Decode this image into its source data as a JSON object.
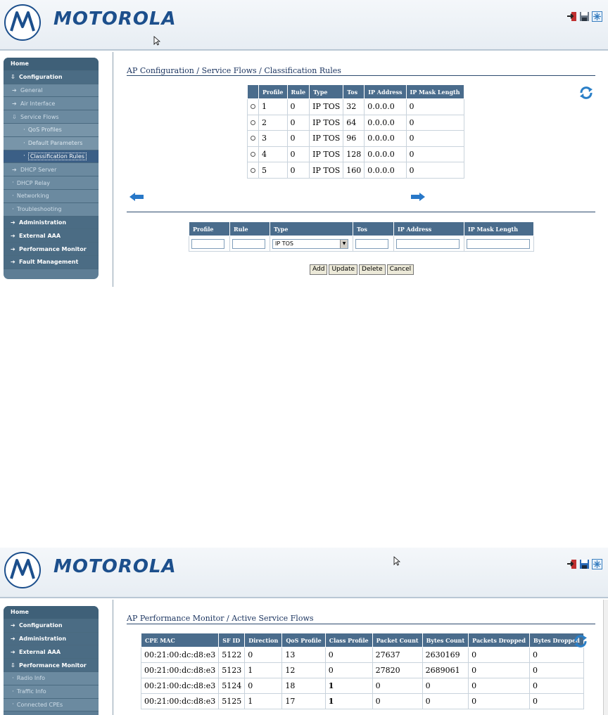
{
  "brand": {
    "name": "MOTOROLA",
    "primary_color": "#1c4f8c",
    "nav_color": "#5d7d95",
    "table_header_color": "#4a6c8c"
  },
  "header_icons": [
    "logout-icon",
    "save-icon",
    "reboot-icon"
  ],
  "screen1": {
    "sidebar": {
      "home": "Home",
      "configuration": "Configuration",
      "general": "General",
      "air_interface": "Air Interface",
      "service_flows": "Service Flows",
      "qos_profiles": "QoS Profiles",
      "default_parameters": "Default Parameters",
      "classification_rules": "Classification Rules",
      "dhcp_server": "DHCP Server",
      "dhcp_relay": "DHCP Relay",
      "networking": "Networking",
      "troubleshooting": "Troubleshooting",
      "administration": "Administration",
      "external_aaa": "External AAA",
      "performance_monitor": "Performance Monitor",
      "fault_management": "Fault Management"
    },
    "breadcrumb": "AP Configuration / Service Flows / Classification Rules",
    "table": {
      "headers": [
        "",
        "Profile",
        "Rule",
        "Type",
        "Tos",
        "IP Address",
        "IP Mask Length"
      ],
      "rows": [
        [
          "1",
          "0",
          "IP TOS",
          "32",
          "0.0.0.0",
          "0"
        ],
        [
          "2",
          "0",
          "IP TOS",
          "64",
          "0.0.0.0",
          "0"
        ],
        [
          "3",
          "0",
          "IP TOS",
          "96",
          "0.0.0.0",
          "0"
        ],
        [
          "4",
          "0",
          "IP TOS",
          "128",
          "0.0.0.0",
          "0"
        ],
        [
          "5",
          "0",
          "IP TOS",
          "160",
          "0.0.0.0",
          "0"
        ]
      ]
    },
    "form": {
      "headers": [
        "Profile",
        "Rule",
        "Type",
        "Tos",
        "IP Address",
        "IP Mask Length"
      ],
      "type_value": "IP TOS"
    },
    "buttons": {
      "add": "Add",
      "update": "Update",
      "delete": "Delete",
      "cancel": "Cancel"
    }
  },
  "screen2": {
    "sidebar": {
      "home": "Home",
      "configuration": "Configuration",
      "administration": "Administration",
      "external_aaa": "External AAA",
      "performance_monitor": "Performance Monitor",
      "radio_info": "Radio Info",
      "traffic_info": "Traffic Info",
      "connected_cpes": "Connected CPEs"
    },
    "breadcrumb": "AP Performance Monitor / Active Service Flows",
    "table": {
      "headers": [
        "CPE MAC",
        "SF ID",
        "Direction",
        "QoS Profile",
        "Class Profile",
        "Packet Count",
        "Bytes Count",
        "Packets Dropped",
        "Bytes Dropped"
      ],
      "rows": [
        [
          "00:21:00:dc:d8:e3",
          "5122",
          "0",
          "13",
          "0",
          "27637",
          "2630169",
          "0",
          "0"
        ],
        [
          "00:21:00:dc:d8:e3",
          "5123",
          "1",
          "12",
          "0",
          "27820",
          "2689061",
          "0",
          "0"
        ],
        [
          "00:21:00:dc:d8:e3",
          "5124",
          "0",
          "18",
          "1",
          "0",
          "0",
          "0",
          "0"
        ],
        [
          "00:21:00:dc:d8:e3",
          "5125",
          "1",
          "17",
          "1",
          "0",
          "0",
          "0",
          "0"
        ]
      ]
    }
  }
}
